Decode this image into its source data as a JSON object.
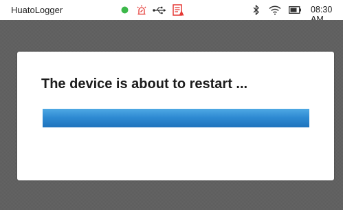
{
  "statusbar": {
    "app_title": "HuatoLogger",
    "time": "08:30 AM",
    "icons": [
      "status-dot-icon",
      "alarm-icon",
      "usb-icon",
      "report-icon",
      "bluetooth-icon",
      "wifi-icon",
      "battery-icon"
    ],
    "colors": {
      "status_dot": "#3cb84a",
      "alarm": "#e53935",
      "report": "#e53935"
    }
  },
  "dialog": {
    "message": "The device is about to restart ...",
    "progress": 1.0,
    "progress_color": "#2f8bd3"
  }
}
